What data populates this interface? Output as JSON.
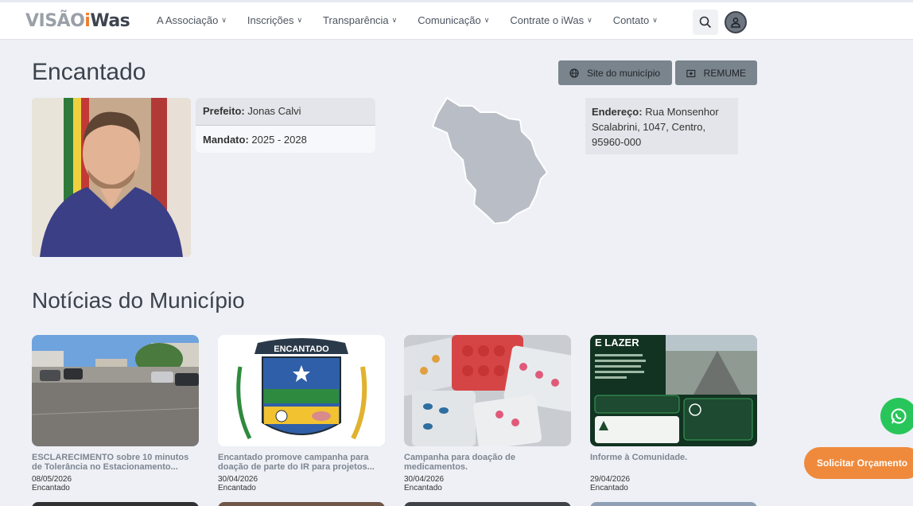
{
  "brand": {
    "part1": "VISÃO",
    "part2": "i",
    "part3": "Was"
  },
  "nav": [
    {
      "label": "A Associação"
    },
    {
      "label": "Inscrições"
    },
    {
      "label": "Transparência"
    },
    {
      "label": "Comunicação"
    },
    {
      "label": "Contrate o iWas"
    },
    {
      "label": "Contato"
    }
  ],
  "page": {
    "title": "Encantado",
    "site_button": "Site do município",
    "remume_button": "REMUME"
  },
  "mayor": {
    "prefeito_label": "Prefeito:",
    "prefeito_name": "Jonas Calvi",
    "mandato_label": "Mandato:",
    "mandato_value": "2025 - 2028"
  },
  "address": {
    "label": "Endereço:",
    "value": "Rua Monsenhor Scalabrini, 1047, Centro, 95960-000"
  },
  "news": {
    "section_title": "Notícias do Município",
    "items": [
      {
        "title": "ESCLARECIMENTO sobre 10 minutos de Tolerância no Estacionamento...",
        "date": "08/05/2026",
        "city": "Encantado"
      },
      {
        "title": "Encantado promove campanha para doação de parte do IR para projetos...",
        "date": "30/04/2026",
        "city": "Encantado",
        "image_text": "ENCANTADO"
      },
      {
        "title": "Campanha para doação de medicamentos.",
        "date": "30/04/2026",
        "city": "Encantado"
      },
      {
        "title": "Informe à Comunidade.",
        "date": "29/04/2026",
        "city": "Encantado",
        "image_text": "E LAZER"
      }
    ]
  },
  "floating": {
    "orcamento_label": "Solicitar Orçamento"
  },
  "colors": {
    "accent": "#f07c2b",
    "whatsapp": "#28c65a",
    "button_gray": "#7a848d",
    "background": "#eef0f6"
  }
}
